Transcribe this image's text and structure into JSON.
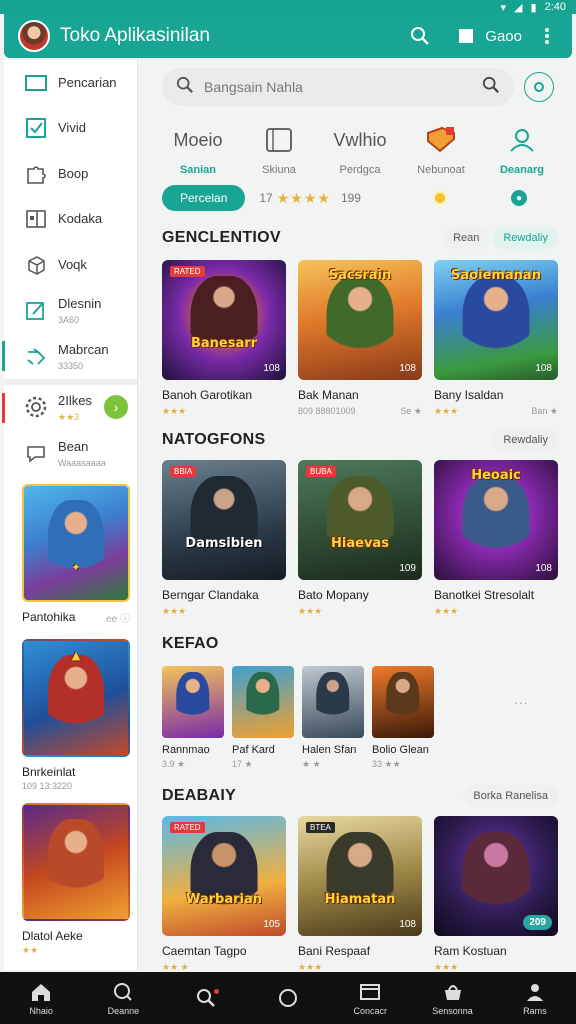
{
  "status": {
    "time": "2:40"
  },
  "header": {
    "title": "Toko Aplikasinilan",
    "action_label": "Gaoo"
  },
  "search": {
    "placeholder": "Bangsain Nahla"
  },
  "sidebar": {
    "items": [
      {
        "label": "Pencarian",
        "sub": "",
        "icon": "square-outline-icon"
      },
      {
        "label": "Vivid",
        "sub": "",
        "icon": "checkbox-icon"
      },
      {
        "label": "Boop",
        "sub": "",
        "icon": "puzzle-icon"
      },
      {
        "label": "Kodaka",
        "sub": "",
        "icon": "window-icon"
      },
      {
        "label": "Voqk",
        "sub": "",
        "icon": "cube-icon"
      },
      {
        "label": "Dlesnin",
        "sub": "3A60",
        "icon": "edit-icon"
      },
      {
        "label": "Mabrcan",
        "sub": "33350",
        "icon": "send-icon"
      },
      {
        "label": "2Ilkes",
        "sub": "★★3",
        "icon": "gear-icon"
      },
      {
        "label": "Bean",
        "sub": "Waaasaaaa",
        "icon": "chat-icon"
      }
    ],
    "cards": [
      {
        "title": "Pantohika",
        "sub": "ee ⓘ"
      },
      {
        "title": "Bnrkeinlat",
        "sub": "109 13:3220"
      },
      {
        "title": "Dlatol Aeke",
        "sub": "★★"
      }
    ]
  },
  "categories": [
    {
      "title": "Moeio",
      "label": "Sanian",
      "highlight": true
    },
    {
      "title": "",
      "label": "Skiuna",
      "highlight": false
    },
    {
      "title": "Vwlhio",
      "label": "Perdgca",
      "highlight": false
    },
    {
      "title": "",
      "label": "Nebunoat",
      "highlight": false
    },
    {
      "title": "",
      "label": "Deanarg",
      "highlight": true
    }
  ],
  "filter": {
    "primary": "Percelan",
    "rating_prefix": "17",
    "stars": "★★★★",
    "count": "199"
  },
  "sections": [
    {
      "title": "GENCLENTIOV",
      "chips": [
        "Rean",
        "Rewdaliy"
      ],
      "cards": [
        {
          "name": "Banoh Garotikan",
          "rating": "★★★",
          "extra": "",
          "badge": "RATED",
          "corner": "108",
          "art": "Banesarr"
        },
        {
          "name": "Bak Manan",
          "rating": "809 88801009",
          "extra": "Se ★",
          "badge": "",
          "corner": "108",
          "art": "Sacsrain"
        },
        {
          "name": "Bany Isaldan",
          "rating": "★★★",
          "extra": "Ban ★",
          "badge": "",
          "corner": "108",
          "art": "Saoiemanan"
        }
      ]
    },
    {
      "title": "NATOGFONS",
      "chips": [
        "Rewdaliy"
      ],
      "cards": [
        {
          "name": "Berngar Clandaka",
          "rating": "★★★",
          "extra": "",
          "badge": "BBIA",
          "corner": "",
          "art": "Damsibien"
        },
        {
          "name": "Bato Mopany",
          "rating": "★★★",
          "extra": "",
          "badge": "BUBA",
          "corner": "109",
          "art": "Hiaevas"
        },
        {
          "name": "Banotkei Stresolalt",
          "rating": "★★★",
          "extra": "",
          "badge": "",
          "corner": "108",
          "art": "Heoaic"
        }
      ]
    },
    {
      "title": "KEFAO",
      "chips": [],
      "small": [
        {
          "name": "Rannmao",
          "meta": "3.9 ★"
        },
        {
          "name": "Paf Kard",
          "meta": "17 ★"
        },
        {
          "name": "Halen Sfan",
          "meta": "★ ★"
        },
        {
          "name": "Bolio Glean",
          "meta": "33 ★★"
        }
      ],
      "more": "···"
    },
    {
      "title": "DEABAIY",
      "chips": [
        "Borka Ranelisa"
      ],
      "cards": [
        {
          "name": "Caemtan Tagpo",
          "rating": "★★ ★",
          "extra": "",
          "badge": "RATED",
          "corner": "105",
          "art": "Warbarian"
        },
        {
          "name": "Bani Respaaf",
          "rating": "★★★",
          "extra": "",
          "badge": "BTEA",
          "corner": "108",
          "art": "Hiamatan"
        },
        {
          "name": "Ram Kostuan",
          "rating": "★★★",
          "extra": "",
          "badge": "",
          "corner": "209",
          "art": ""
        }
      ]
    }
  ],
  "bottom_nav": [
    {
      "label": "Nhaio",
      "icon": "home-icon"
    },
    {
      "label": "Deanne",
      "icon": "search-icon"
    },
    {
      "label": "",
      "icon": "search-alert-icon"
    },
    {
      "label": "",
      "icon": "circle-icon"
    },
    {
      "label": "Concacr",
      "icon": "window-icon"
    },
    {
      "label": "Sensonna",
      "icon": "bag-icon"
    },
    {
      "label": "Rams",
      "icon": "person-icon"
    }
  ],
  "colors": {
    "accent": "#18a594",
    "star": "#e8b23a"
  }
}
